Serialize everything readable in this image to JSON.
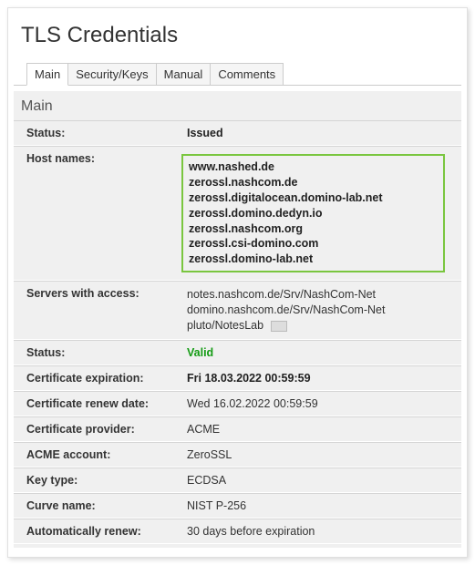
{
  "title": "TLS Credentials",
  "tabs": [
    "Main",
    "Security/Keys",
    "Manual",
    "Comments"
  ],
  "section": "Main",
  "fields": {
    "status_issued": {
      "label": "Status:",
      "value": "Issued"
    },
    "hostnames": {
      "label": "Host names:",
      "values": [
        "www.nashed.de",
        "zerossl.nashcom.de",
        "zerossl.digitalocean.domino-lab.net",
        "zerossl.domino.dedyn.io",
        "zerossl.nashcom.org",
        "zerossl.csi-domino.com",
        "zerossl.domino-lab.net"
      ]
    },
    "servers": {
      "label": "Servers with access:",
      "values": [
        "notes.nashcom.de/Srv/NashCom-Net",
        "domino.nashcom.de/Srv/NashCom-Net",
        "pluto/NotesLab"
      ]
    },
    "status_valid": {
      "label": "Status:",
      "value": "Valid"
    },
    "cert_exp": {
      "label": "Certificate expiration:",
      "value": "Fri 18.03.2022 00:59:59"
    },
    "cert_renew": {
      "label": "Certificate renew date:",
      "value": "Wed 16.02.2022 00:59:59"
    },
    "provider": {
      "label": "Certificate provider:",
      "value": "ACME"
    },
    "acme_acct": {
      "label": "ACME account:",
      "value": "ZeroSSL"
    },
    "key_type": {
      "label": "Key type:",
      "value": "ECDSA"
    },
    "curve": {
      "label": "Curve name:",
      "value": "NIST P-256"
    },
    "auto_renew": {
      "label": "Automatically renew:",
      "value": "30 days before expiration"
    }
  },
  "chart_data": {
    "type": "table",
    "title": "TLS Credentials — Main",
    "rows": [
      {
        "field": "Status",
        "value": "Issued"
      },
      {
        "field": "Host names",
        "value": [
          "www.nashed.de",
          "zerossl.nashcom.de",
          "zerossl.digitalocean.domino-lab.net",
          "zerossl.domino.dedyn.io",
          "zerossl.nashcom.org",
          "zerossl.csi-domino.com",
          "zerossl.domino-lab.net"
        ]
      },
      {
        "field": "Servers with access",
        "value": [
          "notes.nashcom.de/Srv/NashCom-Net",
          "domino.nashcom.de/Srv/NashCom-Net",
          "pluto/NotesLab"
        ]
      },
      {
        "field": "Status",
        "value": "Valid"
      },
      {
        "field": "Certificate expiration",
        "value": "Fri 18.03.2022 00:59:59"
      },
      {
        "field": "Certificate renew date",
        "value": "Wed 16.02.2022 00:59:59"
      },
      {
        "field": "Certificate provider",
        "value": "ACME"
      },
      {
        "field": "ACME account",
        "value": "ZeroSSL"
      },
      {
        "field": "Key type",
        "value": "ECDSA"
      },
      {
        "field": "Curve name",
        "value": "NIST P-256"
      },
      {
        "field": "Automatically renew",
        "value": "30 days before expiration"
      }
    ]
  }
}
